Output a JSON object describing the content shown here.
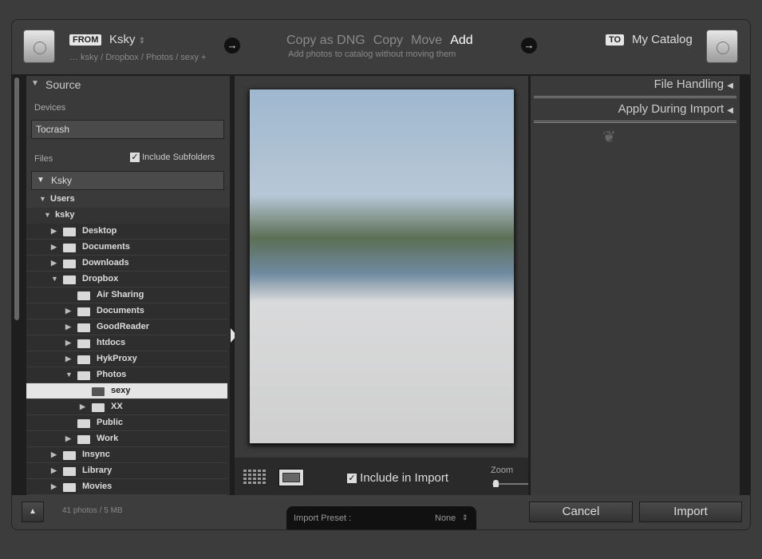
{
  "header": {
    "from_label": "FROM",
    "source": "Ksky",
    "source_path": "… ksky / Dropbox / Photos / sexy +",
    "modes": [
      "Copy as DNG",
      "Copy",
      "Move",
      "Add"
    ],
    "active_mode": "Add",
    "mode_desc": "Add photos to catalog without moving them",
    "to_label": "TO",
    "destination": "My Catalog"
  },
  "source_panel": {
    "title": "Source",
    "devices_label": "Devices",
    "device": "Tocrash",
    "files_label": "Files",
    "include_subfolders": "Include Subfolders",
    "include_subfolders_checked": true,
    "volume": "Ksky",
    "users": "Users",
    "user": "ksky",
    "tree": [
      {
        "label": "Desktop",
        "level": 1,
        "arrow": "right"
      },
      {
        "label": "Documents",
        "level": 1,
        "arrow": "right"
      },
      {
        "label": "Downloads",
        "level": 1,
        "arrow": "right"
      },
      {
        "label": "Dropbox",
        "level": 1,
        "arrow": "down"
      },
      {
        "label": "Air Sharing",
        "level": 2,
        "arrow": ""
      },
      {
        "label": "Documents",
        "level": 2,
        "arrow": "right"
      },
      {
        "label": "GoodReader",
        "level": 2,
        "arrow": "right"
      },
      {
        "label": "htdocs",
        "level": 2,
        "arrow": "right"
      },
      {
        "label": "HykProxy",
        "level": 2,
        "arrow": "right"
      },
      {
        "label": "Photos",
        "level": 2,
        "arrow": "down"
      },
      {
        "label": "sexy",
        "level": 3,
        "arrow": "",
        "selected": true
      },
      {
        "label": "XX",
        "level": 3,
        "arrow": "right"
      },
      {
        "label": "Public",
        "level": 2,
        "arrow": ""
      },
      {
        "label": "Work",
        "level": 2,
        "arrow": "right"
      },
      {
        "label": "Insync",
        "level": 1,
        "arrow": "right"
      },
      {
        "label": "Library",
        "level": 1,
        "arrow": "right"
      },
      {
        "label": "Movies",
        "level": 1,
        "arrow": "right"
      }
    ]
  },
  "preview": {
    "include_in_import": "Include in Import",
    "include_checked": true,
    "zoom_label": "Zoom",
    "zoom_level": 0
  },
  "right_panel": {
    "file_handling": "File Handling",
    "apply_during_import": "Apply During Import"
  },
  "footer": {
    "count": "41 photos / 5 MB",
    "preset_label": "Import Preset :",
    "preset_value": "None",
    "cancel": "Cancel",
    "import": "Import"
  }
}
